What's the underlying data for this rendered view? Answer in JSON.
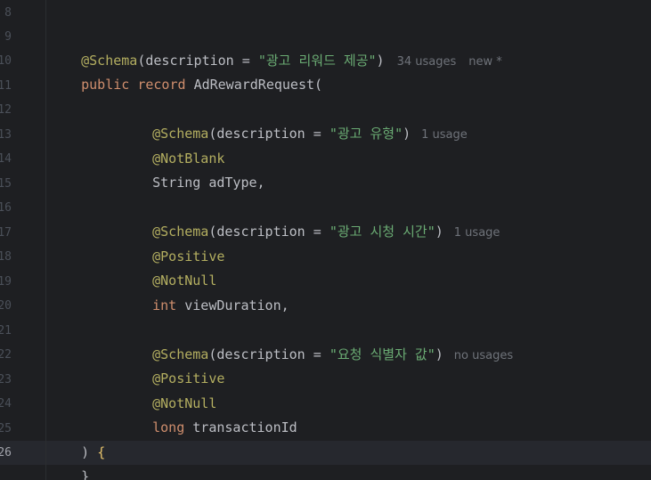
{
  "editor": {
    "line_numbers": [
      "8",
      "9",
      "10",
      "11",
      "12",
      "13",
      "14",
      "15",
      "16",
      "17",
      "18",
      "19",
      "20",
      "21",
      "22",
      "23",
      "24",
      "25",
      "26"
    ],
    "current_line": "26",
    "lines": {
      "l9": {
        "annotation": "@Schema",
        "open": "(",
        "param": "description = ",
        "string": "\"광고 리워드 제공\"",
        "close": ")",
        "usages": "34 usages",
        "new_label": "new *"
      },
      "l10": {
        "kw_public": "public",
        "kw_record": "record",
        "name": "AdRewardRequest("
      },
      "l12": {
        "annotation": "@Schema",
        "open": "(",
        "param": "description = ",
        "string": "\"광고 유형\"",
        "close": ")",
        "usages": "1 usage"
      },
      "l13": {
        "annotation": "@NotBlank"
      },
      "l14": {
        "type": "String",
        "field": " adType,"
      },
      "l16": {
        "annotation": "@Schema",
        "open": "(",
        "param": "description = ",
        "string": "\"광고 시청 시간\"",
        "close": ")",
        "usages": "1 usage"
      },
      "l17": {
        "annotation": "@Positive"
      },
      "l18": {
        "annotation": "@NotNull"
      },
      "l19": {
        "type": "int",
        "field": " viewDuration,"
      },
      "l21": {
        "annotation": "@Schema",
        "open": "(",
        "param": "description = ",
        "string": "\"요청 식별자 값\"",
        "close": ")",
        "usages": "no usages"
      },
      "l22": {
        "annotation": "@Positive"
      },
      "l23": {
        "annotation": "@NotNull"
      },
      "l24": {
        "type": "long",
        "field": " transactionId"
      },
      "l25": {
        "paren": ")",
        "brace": "{"
      },
      "l26": {
        "brace": "}"
      }
    }
  },
  "colors": {
    "background": "#1e1f22",
    "annotation": "#b3ae60",
    "keyword": "#cf8e6d",
    "string": "#6aab73",
    "text": "#bcbec4",
    "hint": "#6f737a",
    "line_number": "#4b5059"
  }
}
